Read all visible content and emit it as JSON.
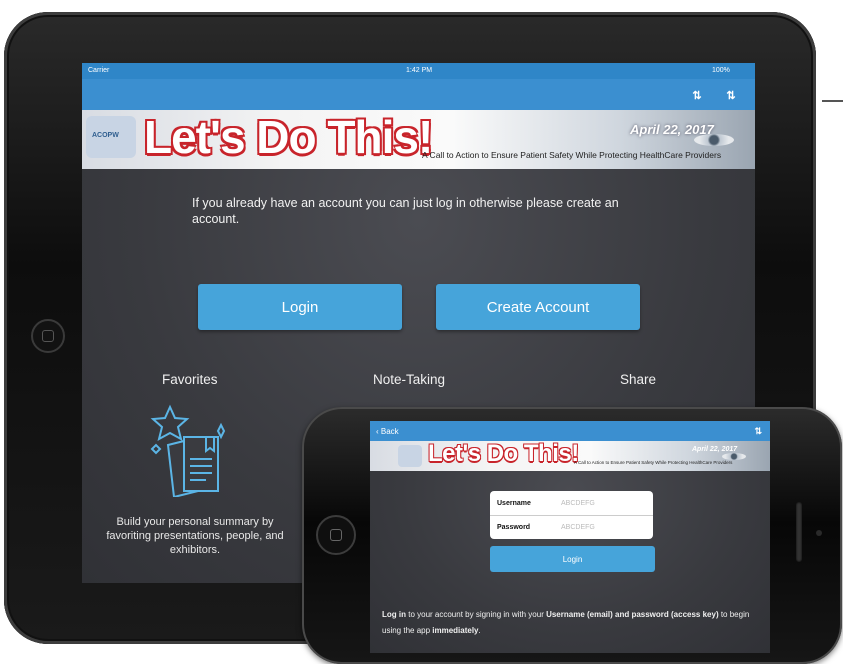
{
  "tablet": {
    "status": {
      "carrier": "Carrier",
      "time": "1:42 PM",
      "battery": "100%"
    },
    "banner": {
      "logo_text": "ACOPW",
      "title": "Let's Do This!",
      "tagline": "A Call to Action to Ensure Patient Safety While Protecting HealthCare Providers",
      "date": "April 22, 2017"
    },
    "intro": "If you already have an account you can just log in otherwise please create an account.",
    "buttons": {
      "login": "Login",
      "create_account": "Create Account"
    },
    "features": [
      {
        "title": "Favorites",
        "description": "Build your personal summary by favoriting presentations, people, and exhibitors."
      },
      {
        "title": "Note-Taking"
      },
      {
        "title": "Share"
      }
    ]
  },
  "phone": {
    "nav": {
      "back": "‹ Back"
    },
    "banner": {
      "title": "Let's Do This!",
      "tagline": "A Call to Action to Ensure Patient Safety While Protecting HealthCare Providers",
      "date": "April 22, 2017"
    },
    "form": {
      "username_label": "Username",
      "username_placeholder": "ABCDEFG",
      "password_label": "Password",
      "password_placeholder": "ABCDEFG",
      "login_button": "Login"
    },
    "note": {
      "p1": "Log in",
      "p2": " to your account by signing in with your ",
      "p3": "Username (email) and password (access key)",
      "p4": " to begin using the app ",
      "p5": "immediately",
      "p6": "."
    }
  },
  "colors": {
    "accent": "#46a4da",
    "navbar": "#3b8fd0",
    "banner_red": "#c8242b"
  }
}
